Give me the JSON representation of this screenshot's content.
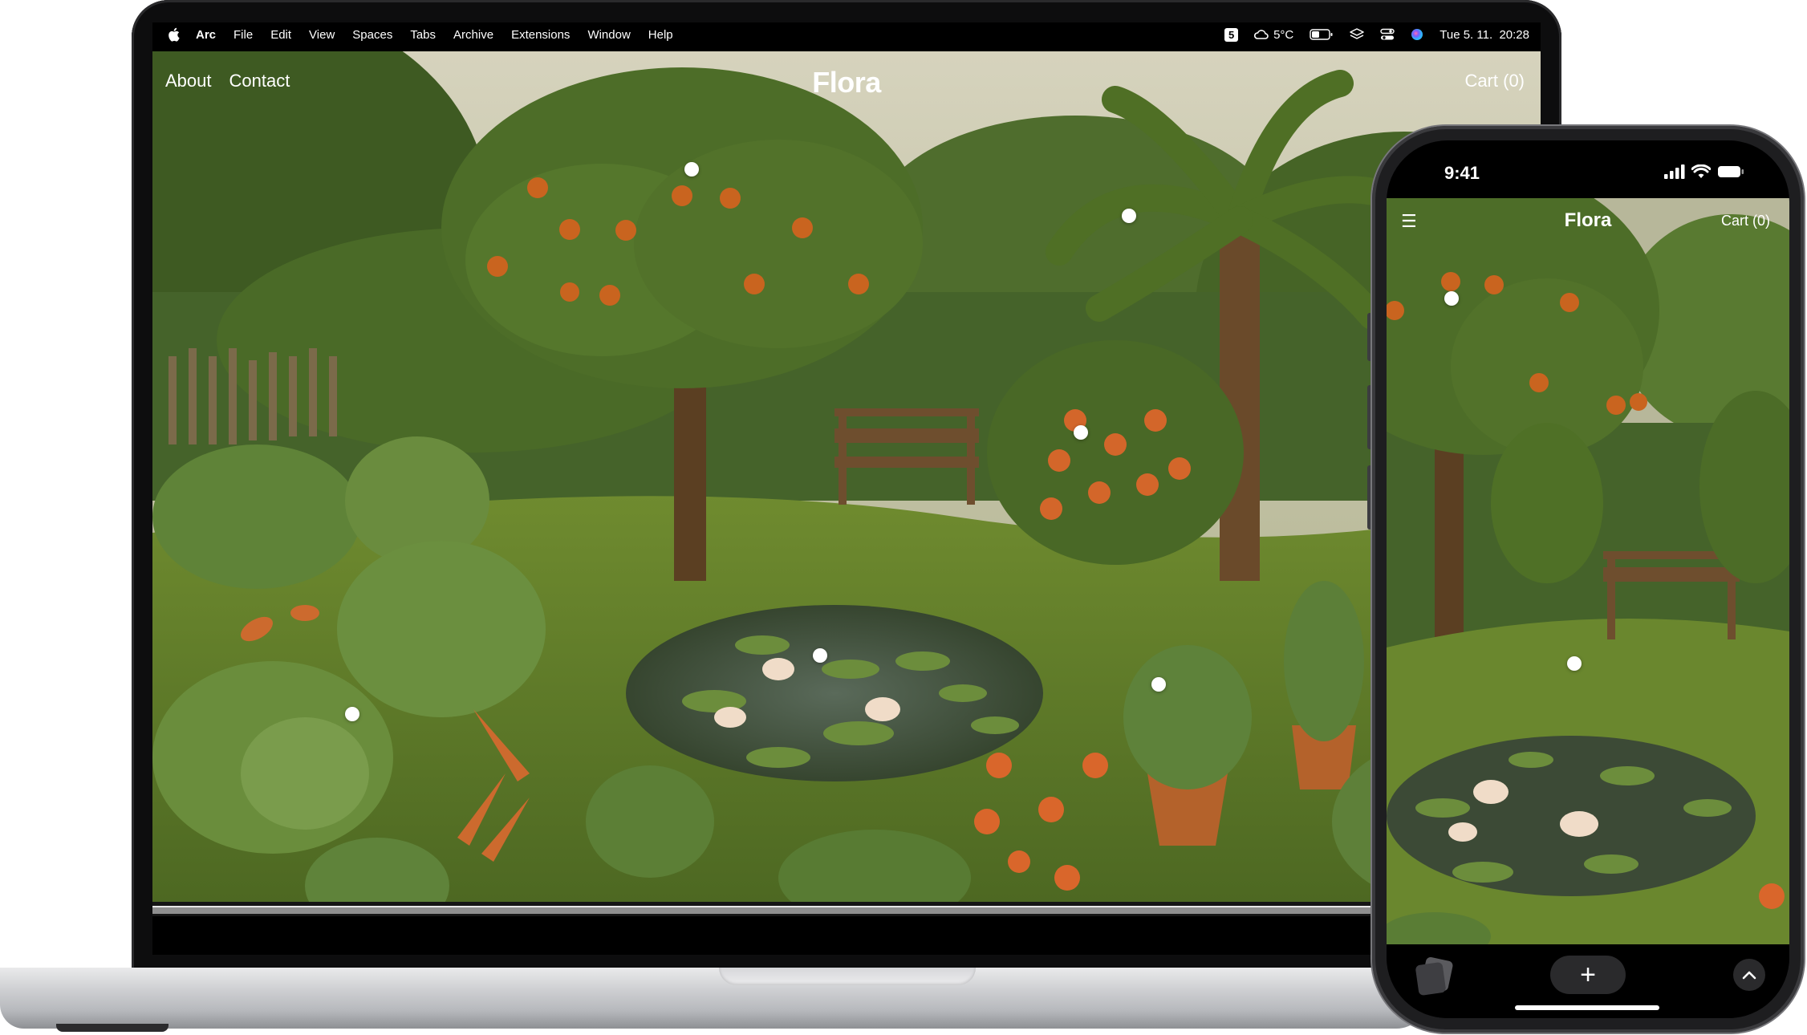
{
  "menubar": {
    "app": "Arc",
    "items": [
      "File",
      "Edit",
      "View",
      "Spaces",
      "Tabs",
      "Archive",
      "Extensions",
      "Window",
      "Help"
    ],
    "status": {
      "badge": "5",
      "weather": "5°C",
      "datetime": "Tue 5. 11.  20:28"
    }
  },
  "site": {
    "nav": [
      "About",
      "Contact"
    ],
    "logo": "Flora",
    "cart": "Cart (0)"
  },
  "phone": {
    "time": "9:41",
    "logo": "Flora",
    "cart": "Cart (0)",
    "menu_icon": "☰",
    "plus": "+"
  },
  "icons": [
    "apple-icon",
    "weather-cloud-icon",
    "battery-icon",
    "layers-icon",
    "control-center-icon",
    "siri-icon",
    "signal-icon",
    "wifi-icon",
    "tabs-icon",
    "chevron-up-icon",
    "menu-icon"
  ],
  "colors": {
    "grass": "#5b7a2c",
    "foliage": "#3f5e22",
    "fruit": "#c9641f",
    "sky": "#cfcfb8"
  }
}
